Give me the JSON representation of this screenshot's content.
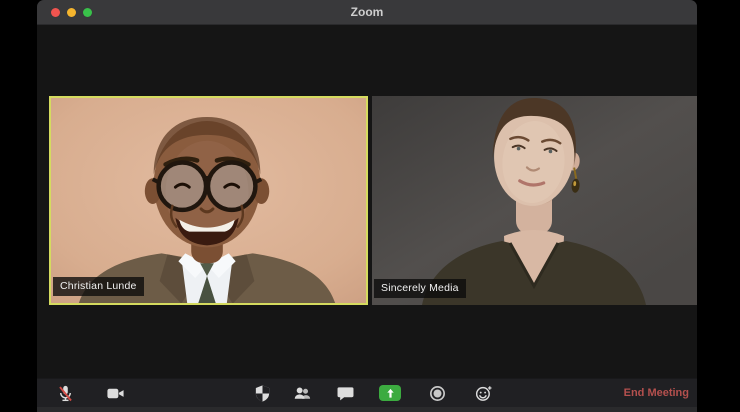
{
  "window": {
    "title": "Zoom"
  },
  "tiles": [
    {
      "name": "Christian Lunde",
      "active_speaker": true
    },
    {
      "name": "Sincerely Media",
      "active_speaker": false
    }
  ],
  "toolbar": {
    "end_meeting_label": "End Meeting",
    "buttons": [
      "mute",
      "stop-video",
      "security",
      "participants",
      "chat",
      "share-screen",
      "record",
      "reactions",
      "end-meeting"
    ]
  },
  "colors": {
    "active_speaker_border": "#d5db5f",
    "share_button_green": "#3cab40",
    "end_meeting_red": "#b4504e",
    "mute_slash_red": "#d24b45",
    "traffic_close": "#f0544f",
    "traffic_minimize": "#f5b52e",
    "traffic_zoom": "#39c14a"
  }
}
